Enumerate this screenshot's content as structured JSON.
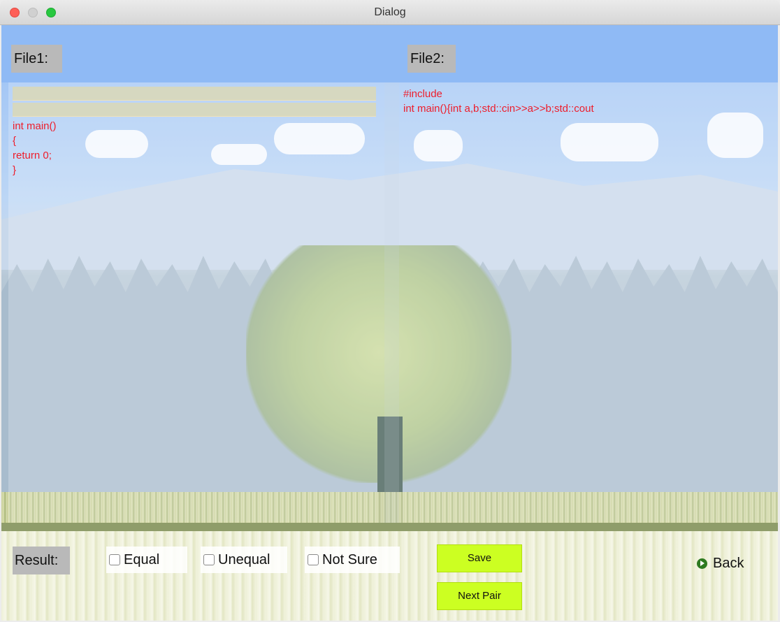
{
  "window": {
    "title": "Dialog"
  },
  "file1": {
    "label": "File1:",
    "lines": [
      "",
      "",
      "int main()",
      "{",
      "return 0;",
      "}"
    ]
  },
  "file2": {
    "label": "File2:",
    "lines": [
      "#include",
      "int main(){int a,b;std::cin>>a>>b;std::cout"
    ]
  },
  "result": {
    "label": "Result:",
    "options": [
      {
        "label": "Equal",
        "checked": false
      },
      {
        "label": "Unequal",
        "checked": false
      },
      {
        "label": "Not Sure",
        "checked": false
      }
    ]
  },
  "buttons": {
    "save": "Save",
    "next_pair": "Next Pair",
    "back": "Back"
  },
  "colors": {
    "code_text": "#ee1d2b",
    "button_bg": "#ccff22",
    "label_bg": "#b9b9b9"
  },
  "icons": {
    "back": "arrow-right-circle-icon"
  }
}
